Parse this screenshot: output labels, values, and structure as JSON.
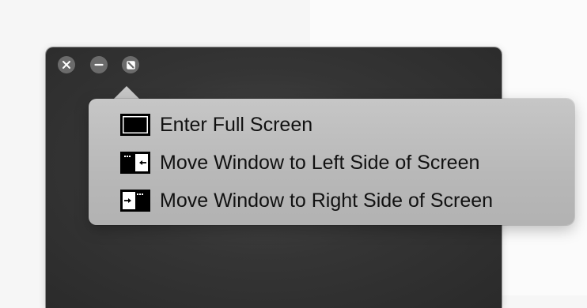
{
  "window": {
    "controls": [
      {
        "name": "close-button",
        "icon": "close-icon"
      },
      {
        "name": "minimize-button",
        "icon": "minimize-icon"
      },
      {
        "name": "fullscreen-button",
        "icon": "fullscreen-icon"
      }
    ]
  },
  "menu": {
    "items": [
      {
        "label": "Enter Full Screen",
        "icon": "enter-full-screen-icon"
      },
      {
        "label": "Move Window to Left Side of Screen",
        "icon": "tile-left-icon"
      },
      {
        "label": "Move Window to Right Side of Screen",
        "icon": "tile-right-icon"
      }
    ]
  },
  "colors": {
    "window_bg": "#353535",
    "popover_bg": "#bcbcbc",
    "control_gray": "#6b6b6b",
    "text": "#111111"
  }
}
